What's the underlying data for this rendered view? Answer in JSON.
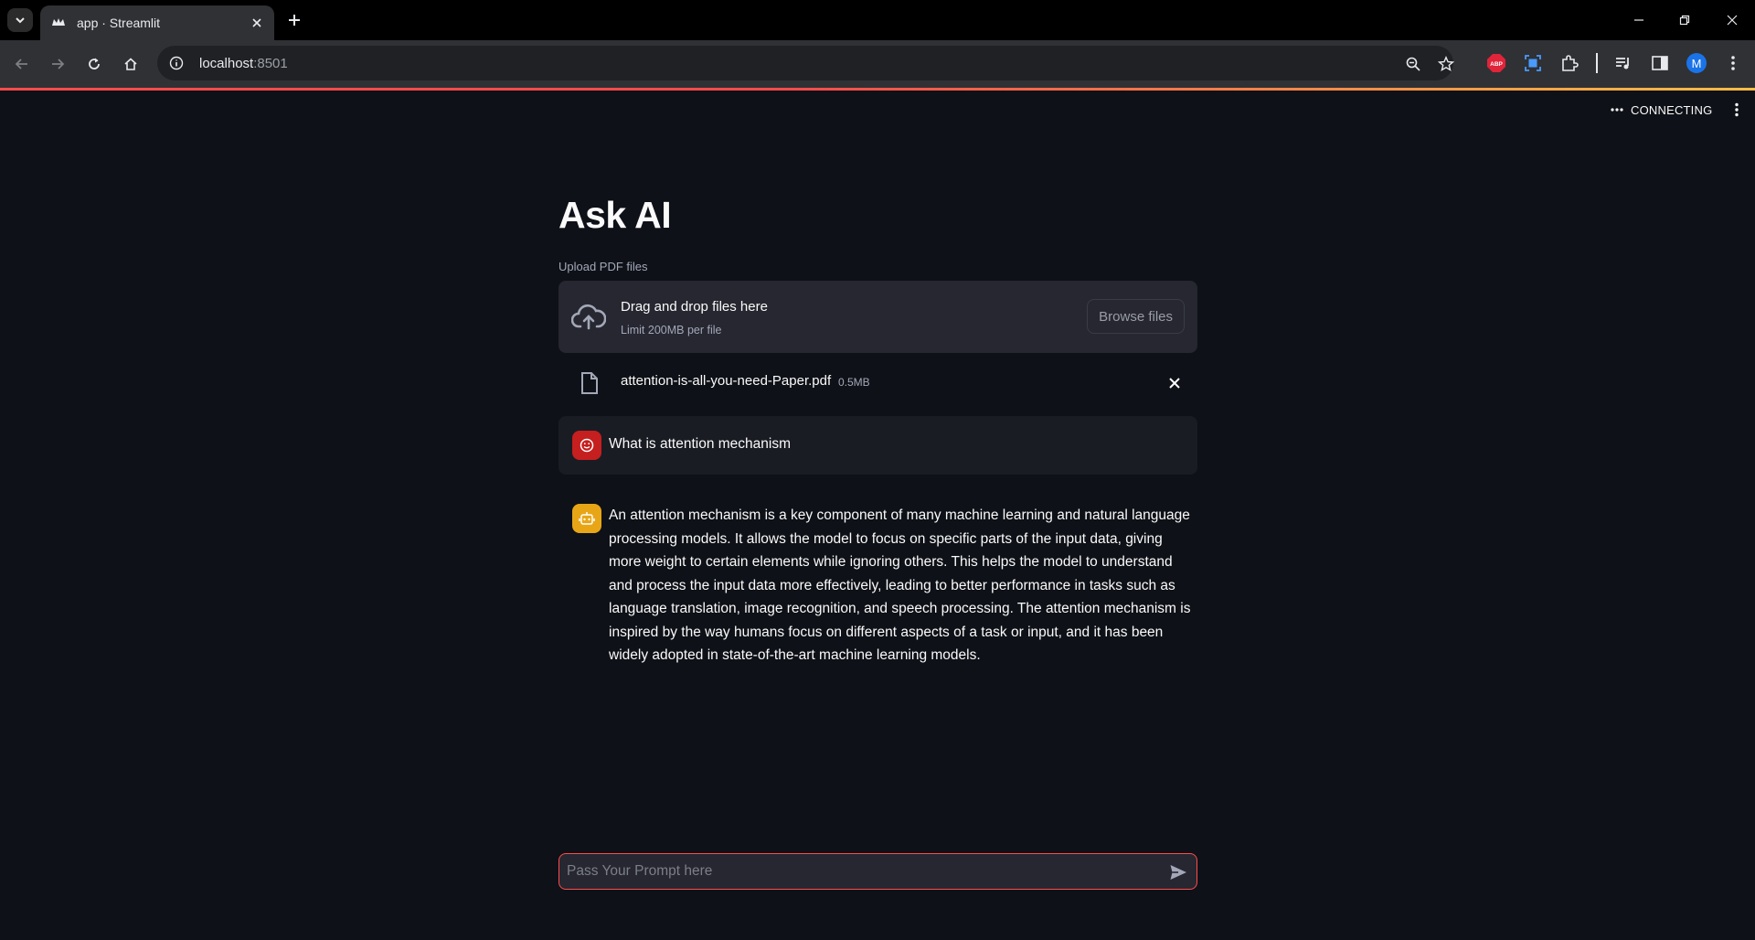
{
  "browser": {
    "tab_title": "app · Streamlit",
    "url_host": "localhost",
    "url_port": ":8501",
    "profile_initial": "M",
    "abp_label": "ABP"
  },
  "header": {
    "status": "CONNECTING"
  },
  "app": {
    "title": "Ask AI",
    "uploader": {
      "label": "Upload PDF files",
      "drop_title": "Drag and drop files here",
      "limit": "Limit 200MB per file",
      "browse_label": "Browse files"
    },
    "files": [
      {
        "name": "attention-is-all-you-need-Paper.pdf",
        "size": "0.5MB"
      }
    ],
    "messages": [
      {
        "role": "user",
        "text": "What is attention mechanism"
      },
      {
        "role": "assistant",
        "text": "An attention mechanism is a key component of many machine learning and natural language processing models. It allows the model to focus on specific parts of the input data, giving more weight to certain elements while ignoring others. This helps the model to understand and process the input data more effectively, leading to better performance in tasks such as language translation, image recognition, and speech processing. The attention mechanism is inspired by the way humans focus on different aspects of a task or input, and it has been widely adopted in state-of-the-art machine learning models."
      }
    ],
    "chat_input": {
      "placeholder": "Pass Your Prompt here",
      "value": ""
    }
  },
  "colors": {
    "accent": "#ff4b4b",
    "background": "#0e1117",
    "user_avatar": "#c51f1f",
    "assistant_avatar": "#e8a617"
  }
}
